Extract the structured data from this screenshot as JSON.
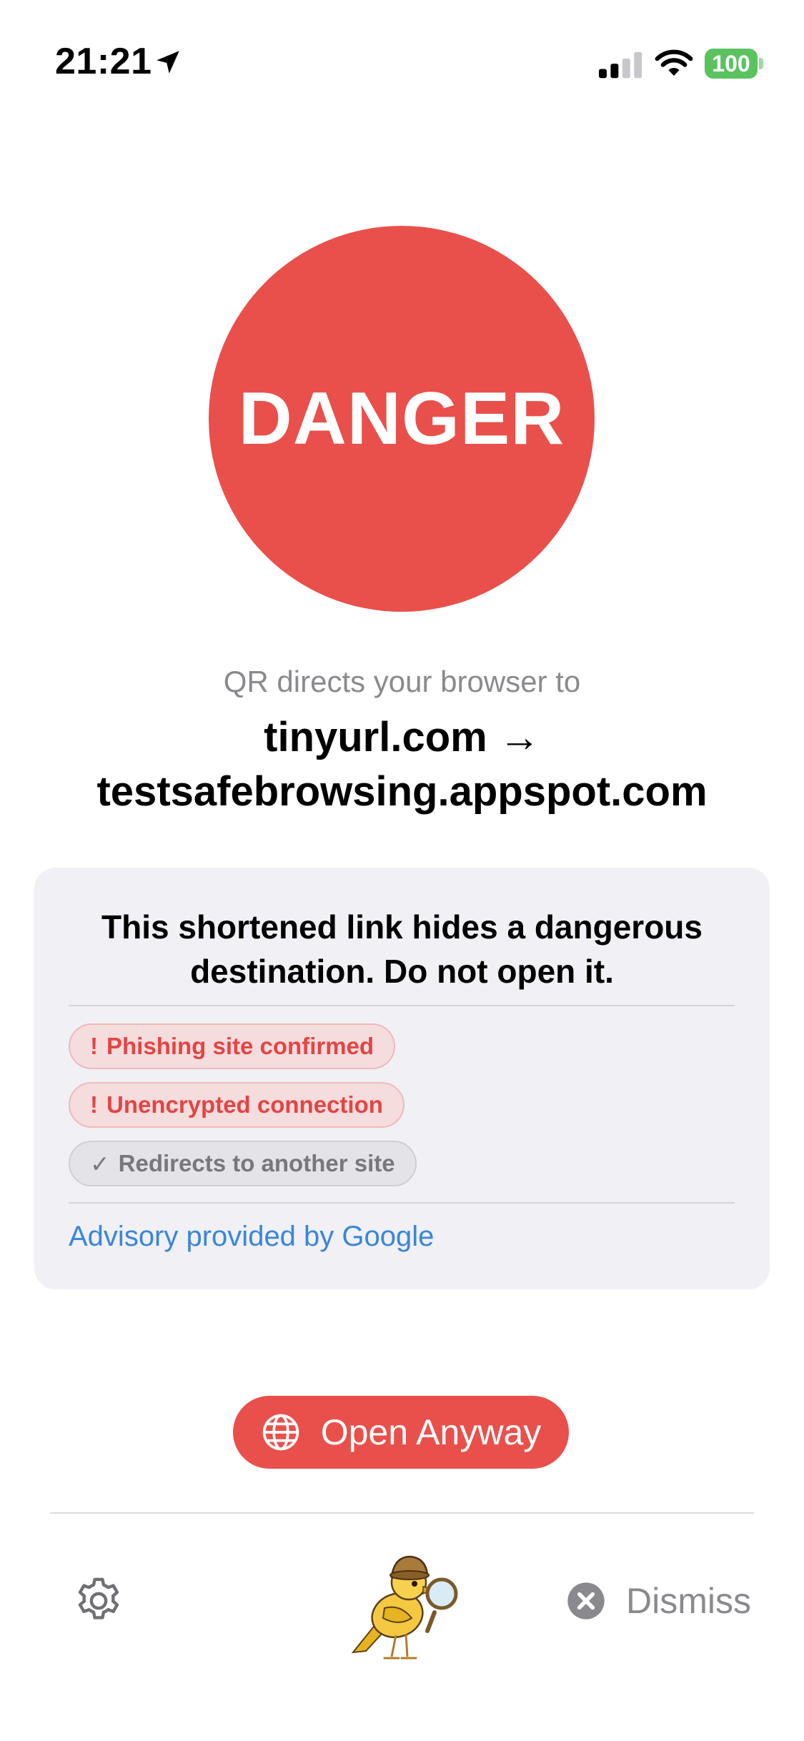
{
  "status_bar": {
    "time": "21:21",
    "battery": "100",
    "icons": [
      "location-arrow-icon",
      "cellular-signal-icon",
      "wifi-icon",
      "battery-icon"
    ]
  },
  "danger": {
    "label": "DANGER",
    "color": "#e9504b"
  },
  "destination": {
    "subtitle": "QR directs your browser to",
    "line1": "tinyurl.com →",
    "line2": "testsafebrowsing.appspot.com"
  },
  "advisory_card": {
    "title": "This shortened link hides a dangerous destination. Do not open it.",
    "tags": [
      {
        "icon": "!",
        "label": "Phishing site confirmed",
        "status": "danger"
      },
      {
        "icon": "!",
        "label": "Unencrypted connection",
        "status": "danger"
      },
      {
        "icon": "✓",
        "label": "Redirects to another site",
        "status": "neutral"
      }
    ],
    "advisory_link": "Advisory provided by Google"
  },
  "actions": {
    "open_label": "Open Anyway",
    "open_icon": "globe-icon",
    "dismiss_label": "Dismiss",
    "dismiss_icon": "close-circle-icon",
    "settings_icon": "gear-icon"
  },
  "colors": {
    "danger": "#e9504b",
    "link": "#3a86d8",
    "battery": "#5ac35f",
    "tag_danger_text": "#e34545",
    "tag_neutral_text": "#77777c"
  }
}
